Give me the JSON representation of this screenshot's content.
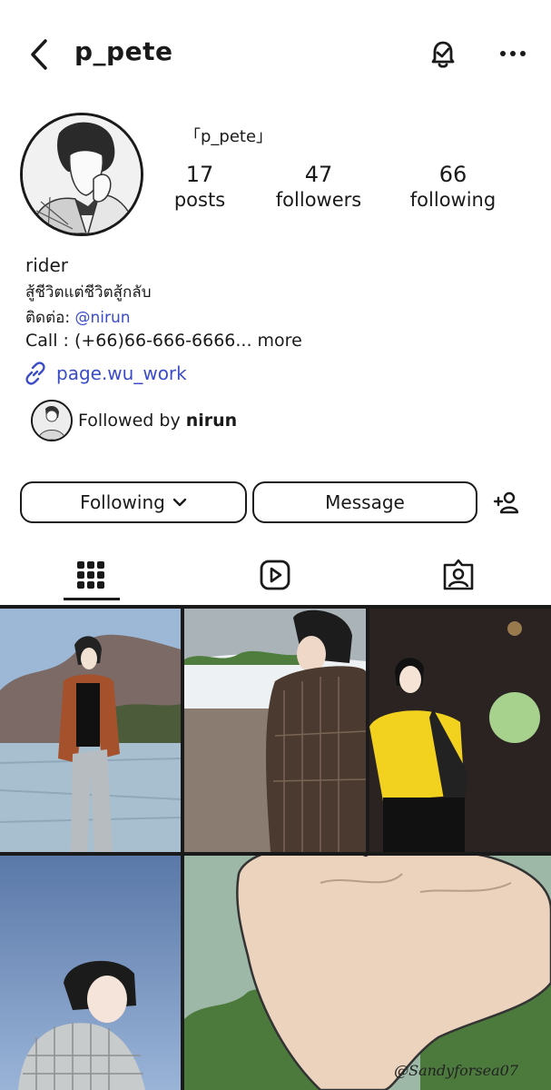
{
  "header": {
    "username": "p_pete"
  },
  "profile": {
    "display_name": "「p_pete」",
    "stats": [
      {
        "value": "17",
        "label": "posts"
      },
      {
        "value": "47",
        "label": "followers"
      },
      {
        "value": "66",
        "label": "following"
      }
    ]
  },
  "bio": {
    "name": "rider",
    "line1": "สู้ชีวิตแต่ชีวิตสู้กลับ",
    "contact_prefix": "ติดต่อ: ",
    "contact_mention": "@nirun",
    "call_text": "Call : (+66)66-666-6666...",
    "more_label": " more",
    "link": "page.wu_work",
    "followed_by_prefix": "Followed by ",
    "followed_by_user": "nirun"
  },
  "actions": {
    "following_label": "Following",
    "message_label": "Message"
  },
  "signature": "@Sandyforsea07",
  "colors": {
    "link": "#3b4cc8",
    "text": "#1a1a1a",
    "background": "#ffffff"
  },
  "icons": {
    "back": "chevron-left-icon",
    "notifications": "bell-icon",
    "more": "more-horizontal-icon",
    "link": "link-icon",
    "dropdown": "chevron-down-icon",
    "suggest": "add-person-icon",
    "grid_tab": "grid-icon",
    "reels_tab": "reels-icon",
    "tagged_tab": "tagged-icon"
  }
}
